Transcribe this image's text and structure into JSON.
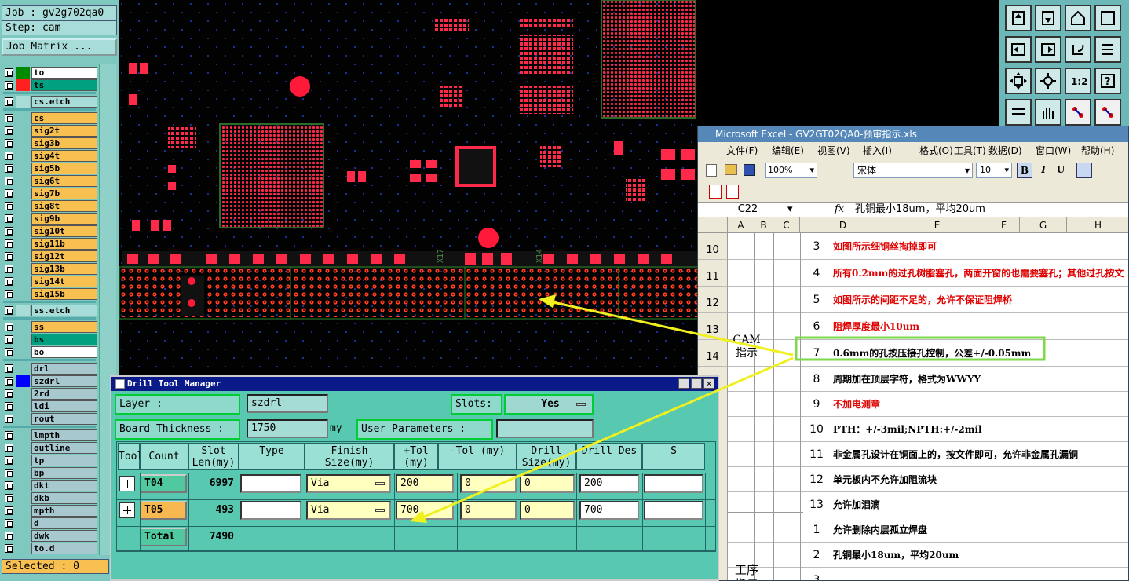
{
  "job": {
    "job_label": "Job : gv2g702qa0",
    "step_label": "Step: cam",
    "matrix_button": "Job Matrix ..."
  },
  "layers": [
    {
      "name": "to",
      "color": "#ffffff",
      "swatch": "#008a00"
    },
    {
      "name": "ts",
      "color": "#00a080",
      "swatch": "#ff2020"
    },
    {
      "name": "cs.etch",
      "color": "#a8dcd8",
      "swatch": "#a8dcd8"
    },
    {
      "name": "cs",
      "color": "#f8c050",
      "swatch": ""
    },
    {
      "name": "sig2t",
      "color": "#f8c050",
      "swatch": ""
    },
    {
      "name": "sig3b",
      "color": "#f8c050",
      "swatch": ""
    },
    {
      "name": "sig4t",
      "color": "#f8c050",
      "swatch": ""
    },
    {
      "name": "sig5b",
      "color": "#f8c050",
      "swatch": ""
    },
    {
      "name": "sig6t",
      "color": "#f8c050",
      "swatch": ""
    },
    {
      "name": "sig7b",
      "color": "#f8c050",
      "swatch": ""
    },
    {
      "name": "sig8t",
      "color": "#f8c050",
      "swatch": ""
    },
    {
      "name": "sig9b",
      "color": "#f8c050",
      "swatch": ""
    },
    {
      "name": "sig10t",
      "color": "#f8c050",
      "swatch": ""
    },
    {
      "name": "sig11b",
      "color": "#f8c050",
      "swatch": ""
    },
    {
      "name": "sig12t",
      "color": "#f8c050",
      "swatch": ""
    },
    {
      "name": "sig13b",
      "color": "#f8c050",
      "swatch": ""
    },
    {
      "name": "sig14t",
      "color": "#f8c050",
      "swatch": ""
    },
    {
      "name": "sig15b",
      "color": "#f8c050",
      "swatch": ""
    },
    {
      "name": "ss.etch",
      "color": "#a8dcd8",
      "swatch": "#a8dcd8"
    },
    {
      "name": "ss",
      "color": "#f8c050",
      "swatch": ""
    },
    {
      "name": "bs",
      "color": "#00a080",
      "swatch": ""
    },
    {
      "name": "bo",
      "color": "#ffffff",
      "swatch": ""
    },
    {
      "name": "drl",
      "color": "#a8c8d0",
      "swatch": ""
    },
    {
      "name": "szdrl",
      "color": "#a8c8d0",
      "swatch": "#0000ff"
    },
    {
      "name": "2rd",
      "color": "#a8c8d0",
      "swatch": ""
    },
    {
      "name": "ldi",
      "color": "#a8c8d0",
      "swatch": ""
    },
    {
      "name": "rout",
      "color": "#a8c8d0",
      "swatch": ""
    },
    {
      "name": "lmpth",
      "color": "#a8c8d0",
      "swatch": ""
    },
    {
      "name": "outline",
      "color": "#a8c8d0",
      "swatch": ""
    },
    {
      "name": "tp",
      "color": "#a8c8d0",
      "swatch": ""
    },
    {
      "name": "bp",
      "color": "#a8c8d0",
      "swatch": ""
    },
    {
      "name": "dkt",
      "color": "#a8c8d0",
      "swatch": ""
    },
    {
      "name": "dkb",
      "color": "#a8c8d0",
      "swatch": ""
    },
    {
      "name": "mpth",
      "color": "#a8c8d0",
      "swatch": ""
    },
    {
      "name": "d",
      "color": "#a8c8d0",
      "swatch": ""
    },
    {
      "name": "dwk",
      "color": "#a8c8d0",
      "swatch": ""
    },
    {
      "name": "to.d",
      "color": "#a8c8d0",
      "swatch": ""
    }
  ],
  "selected": "Selected : 0",
  "pcb_labels": {
    "x17": "X17",
    "x14": "X14"
  },
  "excel": {
    "title": "Microsoft Excel - GV2GT02QA0-预审指示.xls",
    "menu": [
      "文件(F)",
      "编辑(E)",
      "视图(V)",
      "插入(I)",
      "格式(O)",
      "工具(T)",
      "数据(D)",
      "窗口(W)",
      "帮助(H)"
    ],
    "zoom": "100%",
    "font": "宋体",
    "font_size": "10",
    "cell_ref": "C22",
    "formula": "孔铜最小18um，平均20um",
    "columns": [
      "A",
      "B",
      "C",
      "D",
      "E",
      "F",
      "G",
      "H"
    ],
    "row_numbers": [
      "10",
      "11",
      "12",
      "13",
      "14"
    ],
    "section_cam": "CAM指示",
    "section_process": "工序指示",
    "rows": [
      {
        "num": "3",
        "text": "如图所示细铜丝掏掉即可",
        "red": true
      },
      {
        "num": "4",
        "text": "所有0.2mm的过孔树脂塞孔，两面开窗的也需要塞孔；其他过孔按文",
        "red": true
      },
      {
        "num": "5",
        "text": "如图所示的间距不足的，允许不保证阻焊桥",
        "red": true
      },
      {
        "num": "6",
        "text": "阻焊厚度最小10um",
        "red": true
      },
      {
        "num": "7",
        "text": "0.6mm的孔按压接孔控制，公差+/-0.05mm",
        "red": false
      },
      {
        "num": "8",
        "text": "周期加在顶层字符，格式为WWYY",
        "red": false
      },
      {
        "num": "9",
        "text": "不加电测章",
        "red": true
      },
      {
        "num": "10",
        "text": "PTH：+/-3mil;NPTH:+/-2mil",
        "red": false
      },
      {
        "num": "11",
        "text": "非金属孔设计在铜面上的，按文件即可，允许非金属孔漏铜",
        "red": false
      },
      {
        "num": "12",
        "text": "单元板内不允许加阻流块",
        "red": false
      },
      {
        "num": "13",
        "text": "允许加泪滴",
        "red": false
      },
      {
        "num": "1",
        "text": "允许删除内层孤立焊盘",
        "red": false
      },
      {
        "num": "2",
        "text": "孔铜最小18um，平均20um",
        "red": false
      },
      {
        "num": "3",
        "text": "",
        "red": false
      }
    ]
  },
  "dtm": {
    "title": "Drill Tool Manager",
    "layer_label": "Layer        :",
    "layer_value": "szdrl",
    "slots_label": "Slots:",
    "slots_value": "Yes",
    "thickness_label": "Board Thickness :",
    "thickness_value": "1750",
    "thickness_unit": "my",
    "user_params": "User Parameters :",
    "headers": [
      "Tool",
      "Count",
      "Slot Len(my)",
      "Type",
      "Finish Size(my)",
      "+Tol (my)",
      "-Tol (my)",
      "Drill Size(my)",
      "Drill Des",
      "S"
    ],
    "rows": [
      {
        "tool": "T04",
        "count": "6997",
        "type": "Via",
        "finish": "200",
        "ptol": "0",
        "ntol": "0",
        "drill": "200",
        "tool_color": "#50c8a0"
      },
      {
        "tool": "T05",
        "count": "493",
        "type": "Via",
        "finish": "700",
        "ptol": "0",
        "ntol": "0",
        "drill": "700",
        "tool_color": "#f8b850"
      }
    ],
    "total_label": "Total",
    "total_count": "7490"
  }
}
